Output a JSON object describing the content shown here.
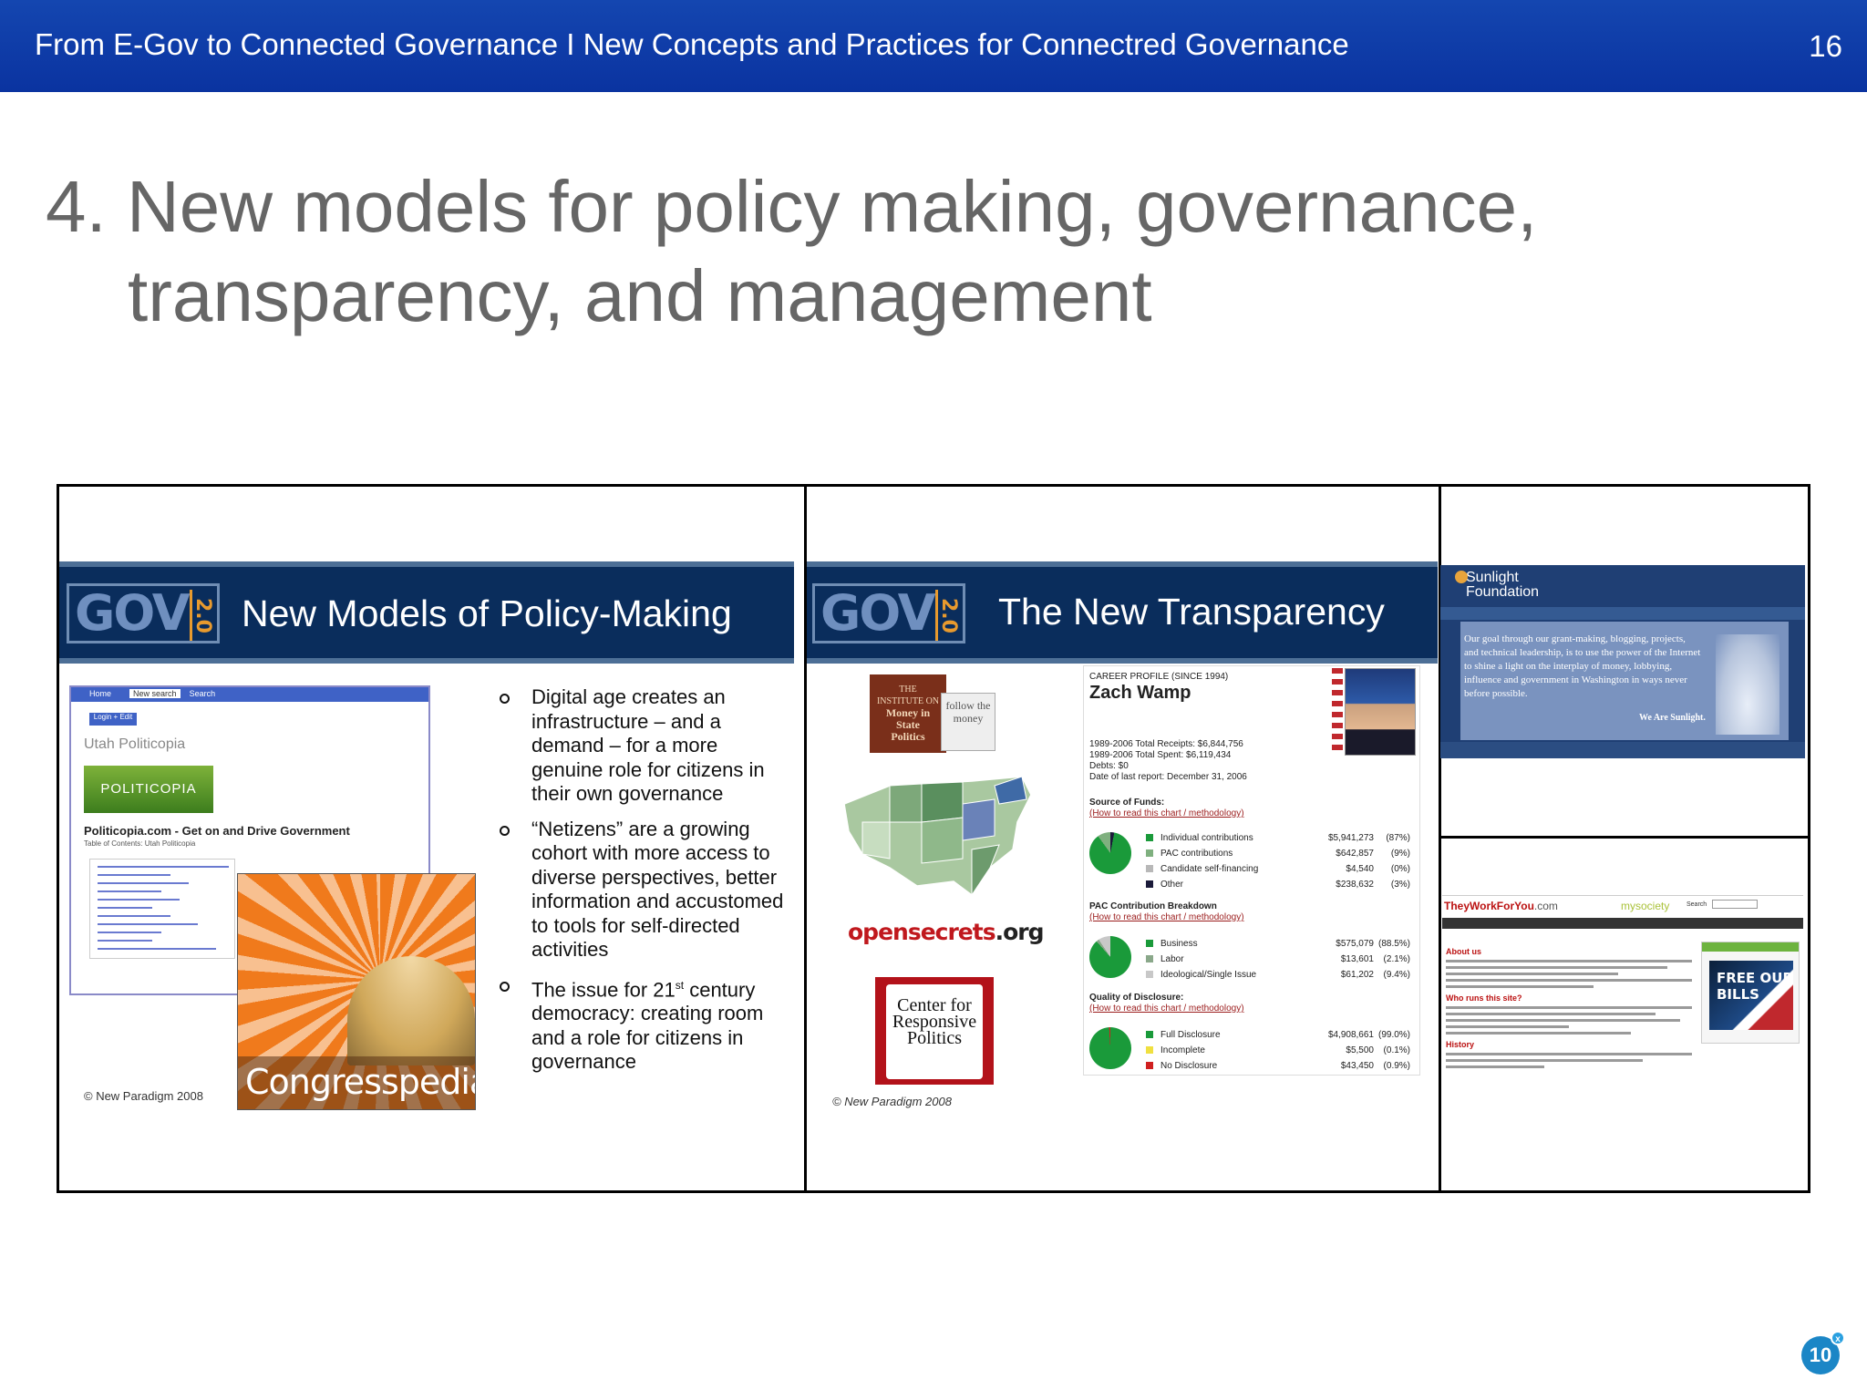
{
  "header": {
    "title": "From E-Gov to Connected Governance I New Concepts and Practices for Connectred Governance",
    "page_number": "16"
  },
  "slide": {
    "title_line1": "4. New models for policy making, governance,",
    "title_line2": "transparency, and management"
  },
  "left_panel": {
    "logo_text": "GOV",
    "logo_version": "2.0",
    "banner_title": "New Models of Policy-Making",
    "politicopia": {
      "nav_home": "Home",
      "nav_search_button": "Search",
      "search_value": "New search",
      "login_button": "Login + Edit",
      "site_title": "Utah Politicopia",
      "banner_text": "POLITICOPIA",
      "description": "Politicopia.com - Get on and Drive Government",
      "toc": "Table of Contents: Utah Politicopia"
    },
    "congresspedia_label": "Congresspedia",
    "copyright": "© New Paradigm 2008",
    "bullets": [
      {
        "text": "Digital age creates an infrastructure – and a demand – for a more genuine role for citizens in their own governance"
      },
      {
        "text": "“Netizens” are a growing cohort with more access to diverse perspectives, better information and accustomed to tools for self-directed activities"
      },
      {
        "pre": "The issue for 21",
        "sup": "st",
        "post": " century democracy:  creating room and a role for citizens in governance"
      }
    ]
  },
  "middle_panel": {
    "logo_text": "GOV",
    "logo_version": "2.0",
    "banner_title": "The New Transparency",
    "mip_logo": {
      "line1": "THE",
      "line2": "INSTITUTE ON",
      "line3": "Money in",
      "line4": "State",
      "line5": "Politics"
    },
    "follow_the_money": "follow the money",
    "opensecrets": {
      "name": "opensecrets",
      "tld": ".org"
    },
    "crp_logo": "Center for Responsive Politics",
    "copyright": "© New Paradigm 2008",
    "profile": {
      "label": "CAREER PROFILE (SINCE 1994)",
      "name": "Zach Wamp",
      "stats": [
        "1989-2006 Total Receipts: $6,844,756",
        "1989-2006 Total Spent: $6,119,434",
        "Debts: $0",
        "Date of last report: December 31, 2006"
      ],
      "sections": [
        {
          "title": "Source of Funds:",
          "link": "(How to read this chart / methodology)",
          "rows": [
            {
              "label": "Individual contributions",
              "amount": "$5,941,273",
              "pct": "(87%)",
              "color": "#1a9a3a"
            },
            {
              "label": "PAC contributions",
              "amount": "$642,857",
              "pct": "(9%)",
              "color": "#7fb07f"
            },
            {
              "label": "Candidate self-financing",
              "amount": "$4,540",
              "pct": "(0%)",
              "color": "#b8b8b8"
            },
            {
              "label": "Other",
              "amount": "$238,632",
              "pct": "(3%)",
              "color": "#1b1b3a"
            }
          ]
        },
        {
          "title": "PAC Contribution Breakdown",
          "link": "(How to read this chart / methodology)",
          "rows": [
            {
              "label": "Business",
              "amount": "$575,079",
              "pct": "(88.5%)",
              "color": "#1a9a3a"
            },
            {
              "label": "Labor",
              "amount": "$13,601",
              "pct": "(2.1%)",
              "color": "#8aa88a"
            },
            {
              "label": "Ideological/Single Issue",
              "amount": "$61,202",
              "pct": "(9.4%)",
              "color": "#c8c8c8"
            }
          ]
        },
        {
          "title": "Quality of Disclosure:",
          "link": "(How to read this chart / methodology)",
          "rows": [
            {
              "label": "Full Disclosure",
              "amount": "$4,908,661",
              "pct": "(99.0%)",
              "color": "#1a9a3a"
            },
            {
              "label": "Incomplete",
              "amount": "$5,500",
              "pct": "(0.1%)",
              "color": "#f0e040"
            },
            {
              "label": "No Disclosure",
              "amount": "$43,450",
              "pct": "(0.9%)",
              "color": "#d02020"
            }
          ]
        }
      ]
    }
  },
  "right_panel": {
    "sunlight": {
      "logo_line1": "Sunlight",
      "logo_line2": "Foundation",
      "quote": "Our goal through our grant-making, blogging, projects, and technical leadership, is to use the power of the Internet to shine a light on the interplay of money, lobbying, influence and government in Washington in ways never before possible.",
      "signoff": "We Are Sunlight."
    },
    "twfy": {
      "brand": "TheyWorkForYou",
      "brand_tld": ".com",
      "mysociety": "mysociety",
      "search_label": "Search",
      "about_heading": "About us",
      "who_heading": "Who runs this site?",
      "history_heading": "History",
      "promo_text": "FREE OUR BILLS"
    }
  },
  "badge": {
    "value": "10",
    "mark": "x"
  }
}
